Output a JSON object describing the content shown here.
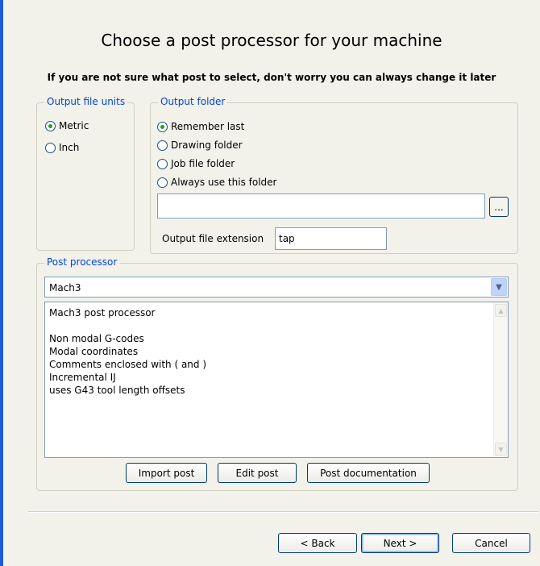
{
  "dialog": {
    "title": "Choose a post processor for your machine",
    "subtitle": "If you are not sure what post to select, don't worry you can always change it later"
  },
  "units": {
    "group_label": "Output file units",
    "options": [
      {
        "label": "Metric",
        "checked": true
      },
      {
        "label": "Inch",
        "checked": false
      }
    ]
  },
  "output_folder": {
    "group_label": "Output folder",
    "options": [
      {
        "label": "Remember last",
        "checked": true
      },
      {
        "label": "Drawing folder",
        "checked": false
      },
      {
        "label": "Job file folder",
        "checked": false
      },
      {
        "label": "Always use this folder",
        "checked": false
      }
    ],
    "path_value": "",
    "browse_label": "...",
    "extension_label": "Output file extension",
    "extension_value": "tap"
  },
  "post_processor": {
    "group_label": "Post processor",
    "selected": "Mach3",
    "description_lines": [
      "Mach3 post processor",
      "",
      "Non modal G-codes",
      "Modal coordinates",
      "Comments enclosed with ( and )",
      "Incremental IJ",
      "uses G43 tool length offsets"
    ],
    "buttons": {
      "import": "Import post",
      "edit": "Edit post",
      "docs": "Post documentation"
    }
  },
  "footer": {
    "back": "< Back",
    "next": "Next >",
    "cancel": "Cancel"
  },
  "colors": {
    "accent_blue": "#0046d5",
    "window_border": "#1f5bd8",
    "radio_checked": "#21a121"
  }
}
